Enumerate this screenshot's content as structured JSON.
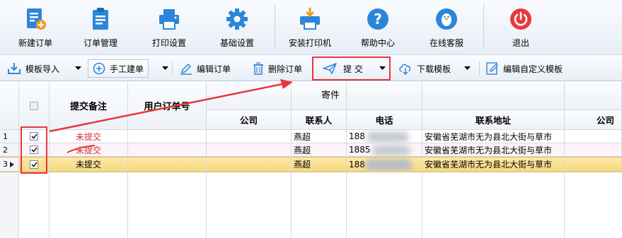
{
  "ribbon": {
    "buttons": [
      {
        "label": "新建订单",
        "icon": "new-order-icon"
      },
      {
        "label": "订单管理",
        "icon": "order-manage-icon"
      },
      {
        "label": "打印设置",
        "icon": "printer-icon"
      },
      {
        "label": "基础设置",
        "icon": "gear-icon"
      },
      {
        "label": "安装打印机",
        "icon": "install-printer-icon"
      },
      {
        "label": "帮助中心",
        "icon": "help-icon"
      },
      {
        "label": "在线客服",
        "icon": "qq-penguin-icon"
      },
      {
        "label": "退出",
        "icon": "power-icon"
      }
    ]
  },
  "toolbar": {
    "import_label": "模板导入",
    "manual_label": "手工建单",
    "edit_label": "编辑订单",
    "delete_label": "删除订单",
    "submit_label": "提 交",
    "download_label": "下载模板",
    "custom_label": "编辑自定义模板"
  },
  "grid": {
    "headers": {
      "remark": "提交备注",
      "user_order_no": "用户订单号",
      "sender_group": "寄件",
      "company": "公司",
      "contact": "联系人",
      "phone": "电话",
      "address": "联系地址",
      "company2": "公司"
    },
    "rows": [
      {
        "num": "1",
        "remark": "未提交",
        "contact": "燕超",
        "phone_visible": "188",
        "address": "安徽省芜湖市无为县北大街与草市"
      },
      {
        "num": "2",
        "remark": "未提交",
        "contact": "燕超",
        "phone_visible": "1885",
        "address": "安徽省芜湖市无为县北大街与草市"
      },
      {
        "num": "3",
        "remark": "未提交",
        "contact": "燕超",
        "phone_visible": "188",
        "address": "安徽省芜湖市无为县北大街与草市"
      }
    ]
  },
  "colors": {
    "annotation_red": "#e8383b",
    "selected_row": "#fbe29a",
    "row2_bg": "#fdf3fb",
    "status_red": "#d43030"
  }
}
